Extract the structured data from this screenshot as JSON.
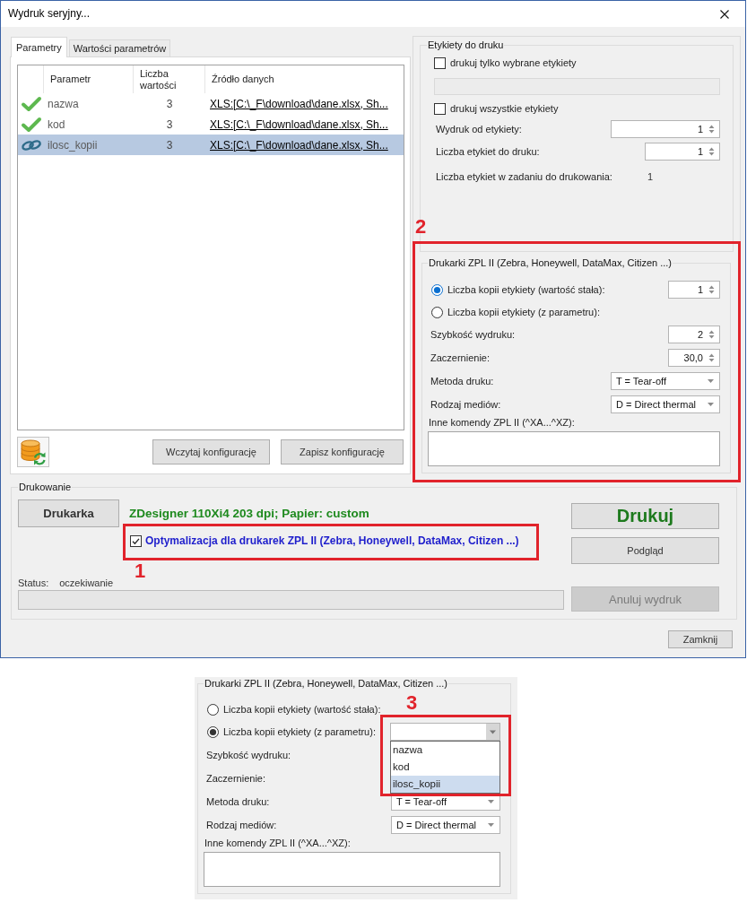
{
  "window": {
    "title": "Wydruk seryjny..."
  },
  "tabs": [
    {
      "label": "Parametry",
      "selected": true
    },
    {
      "label": "Wartości parametrów",
      "selected": false
    }
  ],
  "parameters_table": {
    "columns": [
      "Parametr",
      "Liczba wartości",
      "Źródło danych"
    ],
    "rows": [
      {
        "kind": "ok",
        "name": "nazwa",
        "count": "3",
        "source": "XLS:[C:\\_F\\download\\dane.xlsx, Sh...",
        "selected": false
      },
      {
        "kind": "ok",
        "name": "kod",
        "count": "3",
        "source": "XLS:[C:\\_F\\download\\dane.xlsx, Sh...",
        "selected": false
      },
      {
        "kind": "linked",
        "name": "ilosc_kopii",
        "count": "3",
        "source": "XLS:[C:\\_F\\download\\dane.xlsx, Sh...",
        "selected": true
      }
    ]
  },
  "config_buttons": [
    "Wczytaj konfigurację",
    "Zapisz konfigurację"
  ],
  "labels_group": {
    "title": "Etykiety do druku",
    "rows": [
      {
        "kind": "checkbox",
        "label": "drukuj tylko wybrane etykiety",
        "checked": false
      },
      {
        "kind": "field",
        "disabled": true
      },
      {
        "kind": "checkbox",
        "label": "drukuj wszystkie etykiety",
        "checked": false
      },
      {
        "kind": "spin",
        "label": "Wydruk od etykiety:",
        "value": "1"
      },
      {
        "kind": "spin",
        "label": "Liczba etykiet do druku:",
        "value": "1"
      },
      {
        "kind": "readout",
        "label": "Liczba etykiet w zadaniu do drukowania:",
        "value": "1"
      }
    ]
  },
  "zpl_group": {
    "title": "Drukarki ZPL II (Zebra, Honeywell, DataMax, Citizen ...)",
    "callout": "2",
    "rows": [
      {
        "kind": "radio",
        "label": "Liczba kopii etykiety (wartość stała):",
        "selected": true,
        "focused": true,
        "value": "1"
      },
      {
        "kind": "radio",
        "label": "Liczba kopii etykiety (z parametru):",
        "selected": false,
        "focused": false
      },
      {
        "kind": "spin",
        "label": "Szybkość wydruku:",
        "value": "2"
      },
      {
        "kind": "spin",
        "label": "Zaczernienie:",
        "value": "30,0"
      },
      {
        "kind": "dropdown",
        "label": "Metoda druku:",
        "value": "T = Tear-off"
      },
      {
        "kind": "dropdown",
        "label": "Rodzaj mediów:",
        "value": "D = Direct thermal"
      },
      {
        "kind": "textarea",
        "label": "Inne komendy ZPL II (^XA...^XZ):"
      }
    ]
  },
  "printing": {
    "title": "Drukowanie",
    "printer_button": "Drukarka",
    "printer_info": "ZDesigner 110Xi4 203 dpi; Papier: custom",
    "zpl_optimization": {
      "label": "Optymalizacja dla drukarek ZPL II (Zebra, Honeywell, DataMax, Citizen ...)",
      "checked": true,
      "callout": "1"
    },
    "status_label": "Status:",
    "status": "oczekiwanie",
    "progress": {
      "level": 0
    },
    "buttons": [
      {
        "label": "Drukuj",
        "kind": "primary",
        "disabled": false
      },
      {
        "label": "Podgląd",
        "kind": "normal",
        "disabled": false
      },
      {
        "label": "Anuluj wydruk",
        "kind": "normal",
        "disabled": true
      }
    ]
  },
  "close_button": "Zamknij",
  "inset": {
    "zpl_group": {
      "title": "Drukarki ZPL II (Zebra, Honeywell, DataMax, Citizen ...)",
      "rows": [
        {
          "kind": "radio",
          "label": "Liczba kopii etykiety (wartość stała):",
          "selected": false,
          "focused": false
        },
        {
          "kind": "radio",
          "label": "Liczba kopii etykiety (z parametru):",
          "selected": true,
          "focused": false,
          "combo": {
            "expanded": true,
            "callout": "3",
            "options": [
              {
                "label": "nazwa",
                "selected": false
              },
              {
                "label": "kod",
                "selected": false
              },
              {
                "label": "ilosc_kopii",
                "selected": true
              }
            ]
          }
        },
        {
          "kind": "spin",
          "label": "Szybkość wydruku:"
        },
        {
          "kind": "spin",
          "label": "Zaczernienie:"
        },
        {
          "kind": "dropdown",
          "label": "Metoda druku:",
          "value": "T = Tear-off"
        },
        {
          "kind": "dropdown",
          "label": "Rodzaj mediów:",
          "value": "D = Direct thermal"
        },
        {
          "kind": "textarea",
          "label": "Inne komendy ZPL II (^XA...^XZ):"
        }
      ]
    }
  }
}
